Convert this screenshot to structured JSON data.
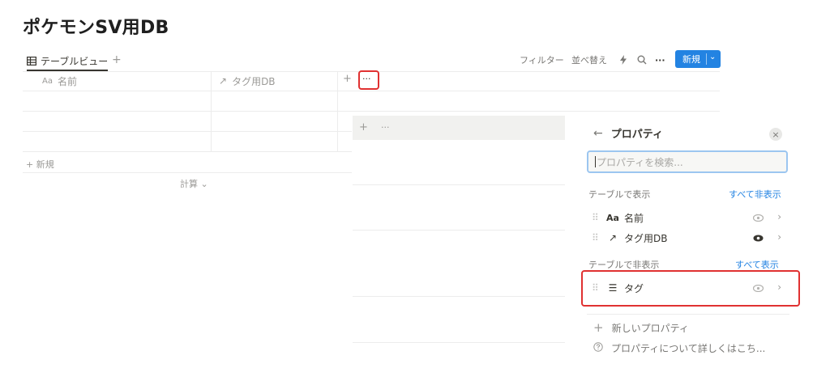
{
  "page": {
    "title": "ポケモンSV用DB"
  },
  "view": {
    "tab_label": "テーブルビュー",
    "add_view": "+"
  },
  "toolbar": {
    "filter": "フィルター",
    "sort": "並べ替え",
    "automation_icon": "lightning-icon",
    "search_icon": "search-icon",
    "more": "···",
    "new_label": "新規",
    "new_chevron": "⌄"
  },
  "table": {
    "columns": [
      {
        "icon": "Aa",
        "label": "名前"
      },
      {
        "icon": "↗",
        "label": "タグ用DB"
      }
    ],
    "add_column": "+",
    "more_column": "···",
    "new_row": "+ 新規",
    "calculate": "計算 ⌄"
  },
  "floating_toolbar": {
    "add": "+",
    "more": "···"
  },
  "panel": {
    "back_icon": "←",
    "title": "プロパティ",
    "close_icon": "×",
    "search_placeholder": "プロパティを検索...",
    "shown_section": {
      "label": "テーブルで表示",
      "action": "すべて非表示"
    },
    "shown_items": [
      {
        "icon": "Aa",
        "name": "名前",
        "visible": true,
        "eye_emphasis": false
      },
      {
        "icon": "↗",
        "name": "タグ用DB",
        "visible": true,
        "eye_emphasis": true
      }
    ],
    "hidden_section": {
      "label": "テーブルで非表示",
      "action": "すべて表示"
    },
    "hidden_items": [
      {
        "icon": "☰",
        "name": "タグ",
        "visible": false
      }
    ],
    "footer": {
      "new_property": "新しいプロパティ",
      "help": "プロパティについて詳しくはこち..."
    }
  },
  "colors": {
    "accent": "#2383e2",
    "highlight": "#e03131",
    "text": "#37352f",
    "muted": "#9b9a97"
  }
}
